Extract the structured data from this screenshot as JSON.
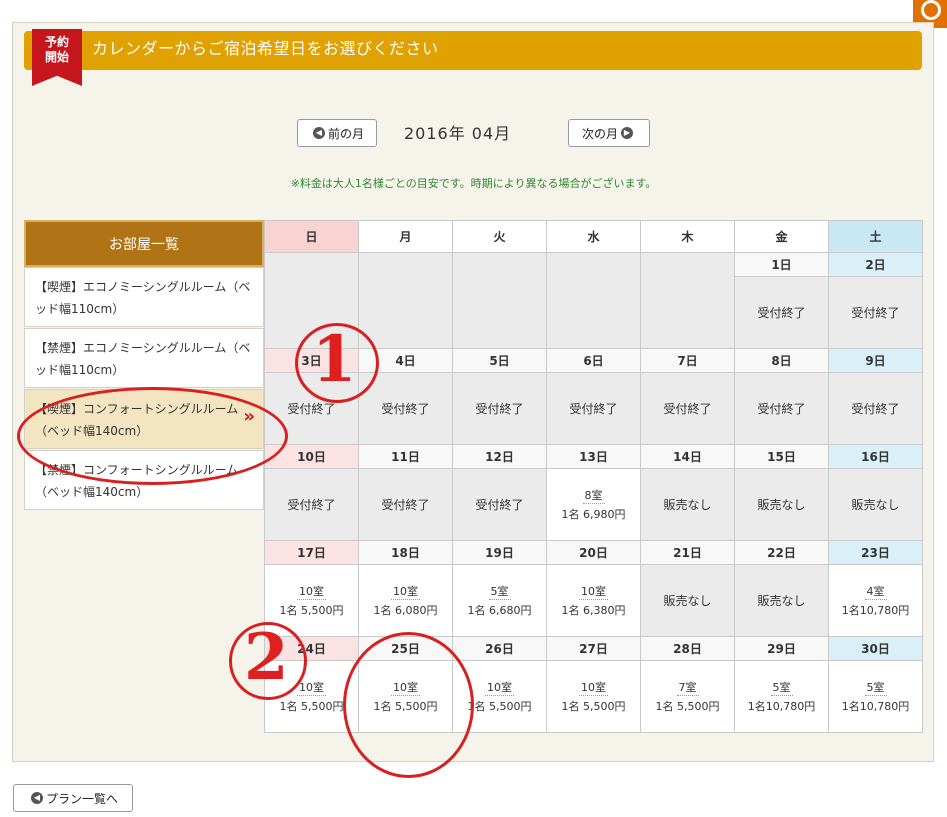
{
  "header": {
    "ribbon_line1": "予約",
    "ribbon_line2": "開始",
    "title": "カレンダーからご宿泊希望日をお選びください"
  },
  "nav": {
    "prev": "前の月",
    "next": "次の月",
    "month": "2016年 04月"
  },
  "note": "※料金は大人1名様ごとの目安です。時期により異なる場合がございます。",
  "rooms": {
    "heading": "お部屋一覧",
    "items": [
      {
        "label": "【喫煙】エコノミーシングルルーム（ベッド幅110cm）",
        "selected": false
      },
      {
        "label": "【禁煙】エコノミーシングルルーム（ベッド幅110cm）",
        "selected": false
      },
      {
        "label": "【喫煙】コンフォートシングルルーム（ベッド幅140cm）",
        "selected": true
      },
      {
        "label": "【禁煙】コンフォートシングルルーム（ベッド幅140cm）",
        "selected": false
      }
    ],
    "arrow": "»"
  },
  "calendar": {
    "weekdays": [
      "日",
      "月",
      "火",
      "水",
      "木",
      "金",
      "土"
    ],
    "weeks": [
      [
        null,
        null,
        null,
        null,
        null,
        {
          "day": "1日",
          "status": "受付終了"
        },
        {
          "day": "2日",
          "status": "受付終了"
        }
      ],
      [
        {
          "day": "3日",
          "status": "受付終了"
        },
        {
          "day": "4日",
          "status": "受付終了"
        },
        {
          "day": "5日",
          "status": "受付終了"
        },
        {
          "day": "6日",
          "status": "受付終了"
        },
        {
          "day": "7日",
          "status": "受付終了"
        },
        {
          "day": "8日",
          "status": "受付終了"
        },
        {
          "day": "9日",
          "status": "受付終了"
        }
      ],
      [
        {
          "day": "10日",
          "status": "受付終了"
        },
        {
          "day": "11日",
          "status": "受付終了"
        },
        {
          "day": "12日",
          "status": "受付終了"
        },
        {
          "day": "13日",
          "rooms": "8室",
          "price": "1名 6,980円"
        },
        {
          "day": "14日",
          "status": "販売なし"
        },
        {
          "day": "15日",
          "status": "販売なし"
        },
        {
          "day": "16日",
          "status": "販売なし"
        }
      ],
      [
        {
          "day": "17日",
          "rooms": "10室",
          "price": "1名 5,500円"
        },
        {
          "day": "18日",
          "rooms": "10室",
          "price": "1名 6,080円"
        },
        {
          "day": "19日",
          "rooms": "5室",
          "price": "1名 6,680円"
        },
        {
          "day": "20日",
          "rooms": "10室",
          "price": "1名 6,380円"
        },
        {
          "day": "21日",
          "status": "販売なし"
        },
        {
          "day": "22日",
          "status": "販売なし"
        },
        {
          "day": "23日",
          "rooms": "4室",
          "price": "1名10,780円"
        }
      ],
      [
        {
          "day": "24日",
          "rooms": "10室",
          "price": "1名 5,500円"
        },
        {
          "day": "25日",
          "rooms": "10室",
          "price": "1名 5,500円"
        },
        {
          "day": "26日",
          "rooms": "10室",
          "price": "1名 5,500円"
        },
        {
          "day": "27日",
          "rooms": "10室",
          "price": "1名 5,500円"
        },
        {
          "day": "28日",
          "rooms": "7室",
          "price": "1名 5,500円"
        },
        {
          "day": "29日",
          "rooms": "5室",
          "price": "1名10,780円"
        },
        {
          "day": "30日",
          "rooms": "5室",
          "price": "1名10,780円"
        }
      ]
    ]
  },
  "footer": {
    "plans_button": "プラン一覧へ"
  },
  "annotations": {
    "one": "1",
    "two": "2"
  },
  "colors": {
    "banner": "#e0a200",
    "ribbon": "#c4161c",
    "room_head": "#b07416",
    "annotation": "#e02020"
  }
}
